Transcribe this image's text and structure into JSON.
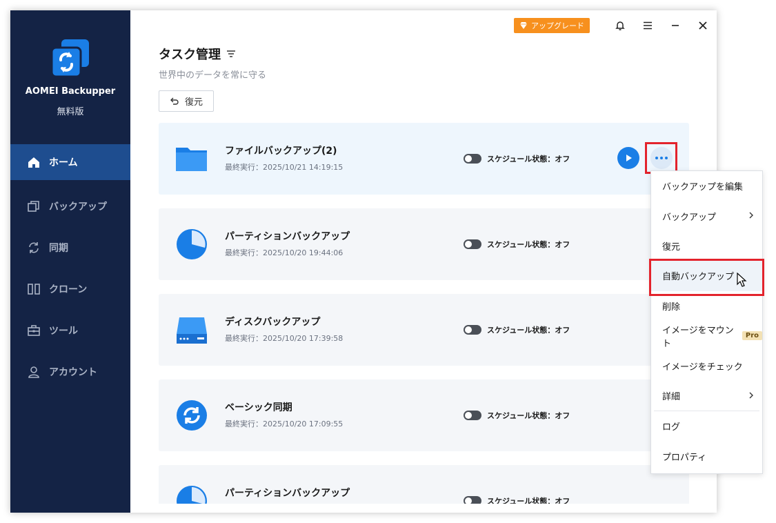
{
  "app": {
    "name": "AOMEI Backupper",
    "edition": "無料版"
  },
  "sidebar": {
    "items": [
      {
        "label": "ホーム",
        "icon": "home-icon",
        "active": true
      },
      {
        "label": "バックアップ",
        "icon": "backup-icon",
        "active": false
      },
      {
        "label": "同期",
        "icon": "sync-icon",
        "active": false
      },
      {
        "label": "クローン",
        "icon": "clone-icon",
        "active": false
      },
      {
        "label": "ツール",
        "icon": "tools-icon",
        "active": false
      },
      {
        "label": "アカウント",
        "icon": "account-icon",
        "active": false
      }
    ]
  },
  "topbar": {
    "upgrade_label": "アップグレード"
  },
  "header": {
    "title": "タスク管理",
    "subtitle": "世界中のデータを常に守る",
    "restore_label": "復元"
  },
  "tasks": [
    {
      "name": "ファイルバックアップ(2)",
      "last_run": "最終実行：2025/10/21 14:19:15",
      "schedule": "スケジュール状態：オフ",
      "icon": "folder-icon"
    },
    {
      "name": "パーティションバックアップ",
      "last_run": "最終実行：2025/10/20 19:44:06",
      "schedule": "スケジュール状態：オフ",
      "icon": "partition-icon"
    },
    {
      "name": "ディスクバックアップ",
      "last_run": "最終実行：2025/10/20 17:39:58",
      "schedule": "スケジュール状態：オフ",
      "icon": "disk-icon"
    },
    {
      "name": "ベーシック同期",
      "last_run": "最終実行：2025/10/20 17:09:55",
      "schedule": "スケジュール状態：オフ",
      "icon": "sync-icon"
    },
    {
      "name": "パーティションバックアップ",
      "last_run": "",
      "schedule": "スケジュール状態：オフ",
      "icon": "partition-icon"
    }
  ],
  "context_menu": {
    "items": [
      {
        "label": "バックアップを編集"
      },
      {
        "label": "バックアップ",
        "submenu": true
      },
      {
        "label": "復元"
      },
      {
        "label": "自動バックアップ",
        "hover": true
      },
      {
        "label": "削除"
      },
      {
        "label": "イメージをマウント",
        "badge": "Pro"
      },
      {
        "label": "イメージをチェック"
      },
      {
        "label": "詳細",
        "submenu": true
      },
      {
        "label": "ログ"
      },
      {
        "label": "プロパティ"
      }
    ]
  },
  "colors": {
    "sidebar_bg": "#142345",
    "sidebar_active": "#1e4d8f",
    "accent": "#1a7ee6",
    "upgrade": "#f7901e",
    "highlight": "#e3232c"
  }
}
